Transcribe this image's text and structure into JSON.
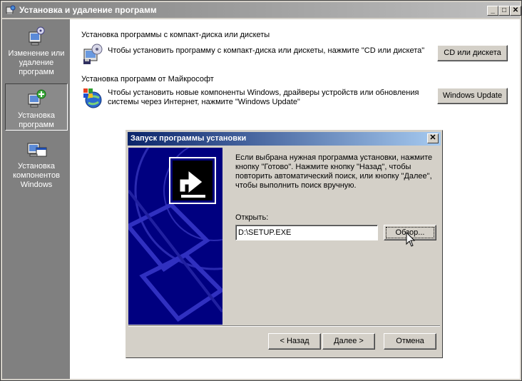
{
  "window": {
    "title": "Установка и удаление программ",
    "controls": {
      "minimize": "_",
      "maximize": "□",
      "close": "✕"
    }
  },
  "sidebar": {
    "items": [
      {
        "label": "Изменение или удаление программ",
        "icon": "change-remove-programs-icon",
        "selected": false
      },
      {
        "label": "Установка программ",
        "icon": "add-programs-icon",
        "selected": true
      },
      {
        "label": "Установка компонентов Windows",
        "icon": "windows-components-icon",
        "selected": false
      }
    ]
  },
  "main": {
    "cd_section": {
      "heading": "Установка программы с компакт-диска или дискеты",
      "description": "Чтобы установить программу с компакт-диска или дискеты, нажмите \"CD или дискета\"",
      "button": "CD или дискета",
      "icon": "cd-floppy-icon"
    },
    "ms_section": {
      "heading": "Установка программ от Майкрософт",
      "description_line1": "Чтобы установить новые компоненты Windows, драйверы устройств или обновления",
      "description_line2": "системы через Интернет, нажмите \"Windows Update\"",
      "button": "Windows Update",
      "icon": "windows-update-icon"
    }
  },
  "dialog": {
    "title": "Запуск программы установки",
    "message": "Если выбрана нужная программа установки, нажмите кнопку \"Готово\".  Нажмите кнопку \"Назад\", чтобы повторить автоматический поиск, или кнопку \"Далее\", чтобы выполнить поиск вручную.",
    "open_label": "Открыть:",
    "open_value": "D:\\SETUP.EXE",
    "browse_button": "Обзор...",
    "back_button": "< Назад",
    "next_button": "Далее >",
    "cancel_button": "Отмена",
    "close": "✕"
  },
  "colors": {
    "title_gradient_start": "#808080",
    "title_gradient_end": "#c0c0c0",
    "dialog_title_start": "#0a246a",
    "dialog_title_end": "#a6caf0",
    "sidebar_bg": "#808080",
    "dialog_art_bg": "#000080"
  }
}
